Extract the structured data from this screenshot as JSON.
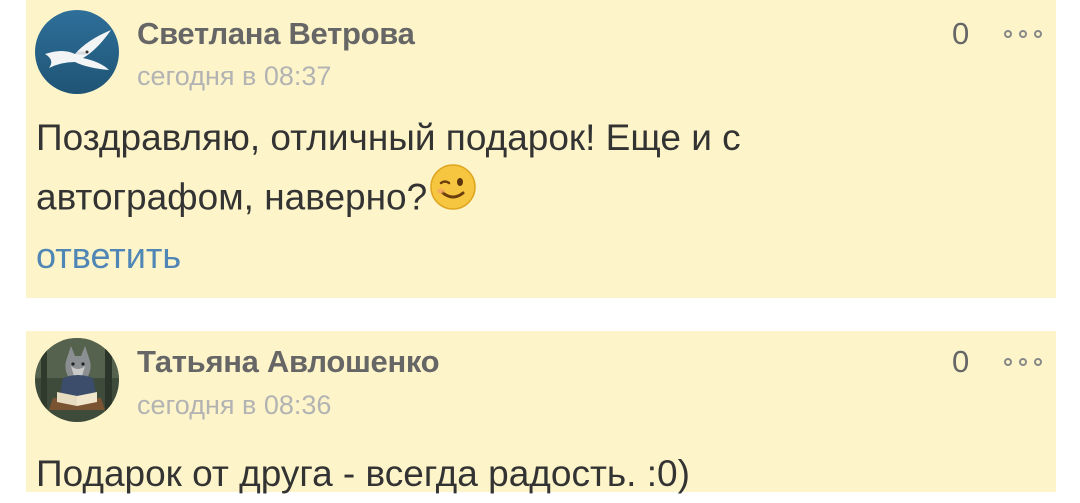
{
  "comments": [
    {
      "author": "Светлана Ветрова",
      "time": "сегодня в 08:37",
      "likes": "0",
      "text_line1": "Поздравляю, отличный подарок! Еще и с",
      "text_line2": "автографом, наверно?",
      "emoji": "winking-face-emoji",
      "reply": "ответить"
    },
    {
      "author": "Татьяна Авлошенко",
      "time": "сегодня в 08:36",
      "likes": "0",
      "text_line1": "Подарок от друга - всегда радость. :0)"
    }
  ],
  "colors": {
    "card_bg": "#fdf5c9",
    "author": "#666666",
    "time": "#b3b3b3",
    "text": "#333333",
    "link": "#4f86b5"
  }
}
